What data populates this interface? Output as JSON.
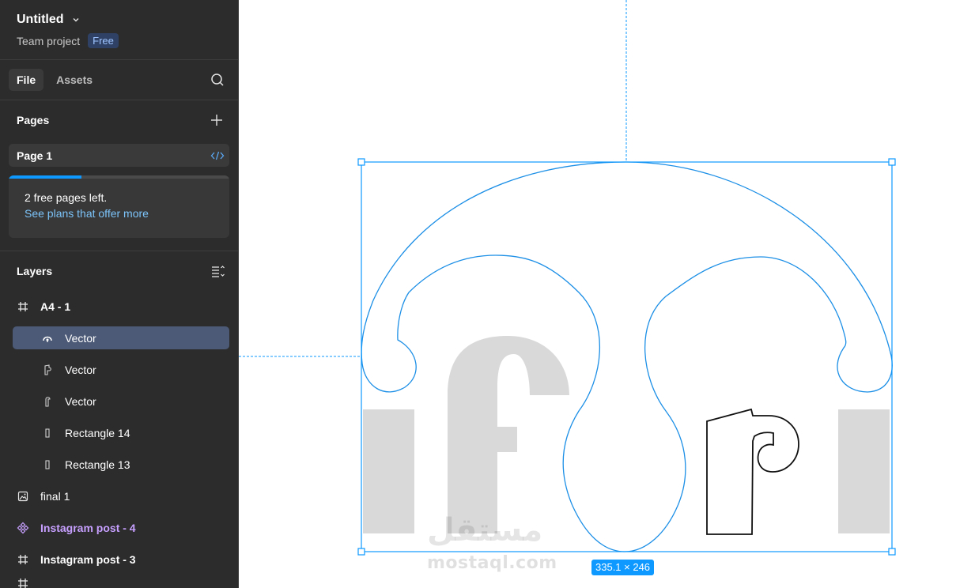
{
  "file": {
    "title": "Untitled",
    "project": "Team project",
    "plan_badge": "Free"
  },
  "tabs": [
    {
      "label": "File",
      "active": true
    },
    {
      "label": "Assets",
      "active": false
    }
  ],
  "pages": {
    "title": "Pages",
    "items": [
      {
        "label": "Page 1"
      }
    ],
    "plan_card": {
      "text": "2 free pages left.",
      "link": "See plans that offer more",
      "progress": 0.33
    }
  },
  "layers": {
    "title": "Layers",
    "items": [
      {
        "label": "A4 - 1",
        "icon": "frame-icon",
        "indent": false,
        "bold": true
      },
      {
        "label": "Vector",
        "icon": "vector-pen-icon",
        "indent": true,
        "selected": true
      },
      {
        "label": "Vector",
        "icon": "vector-path-icon",
        "indent": true
      },
      {
        "label": "Vector",
        "icon": "vector-path-icon",
        "indent": true
      },
      {
        "label": "Rectangle 14",
        "icon": "rectangle-icon",
        "indent": true
      },
      {
        "label": "Rectangle 13",
        "icon": "rectangle-icon",
        "indent": true
      },
      {
        "label": "final 1",
        "icon": "image-icon",
        "indent": false
      },
      {
        "label": "Instagram post - 4",
        "icon": "component-icon",
        "indent": false,
        "purple": true
      },
      {
        "label": "Instagram post - 3",
        "icon": "frame-icon",
        "indent": false,
        "bold": true
      }
    ]
  },
  "canvas": {
    "dimension_label": "335.1 × 246",
    "watermark_ar": "مستقل",
    "watermark_en": "mostaql.com",
    "selection_color": "#0d99ff",
    "shape_gray": "#d9d9d9"
  }
}
